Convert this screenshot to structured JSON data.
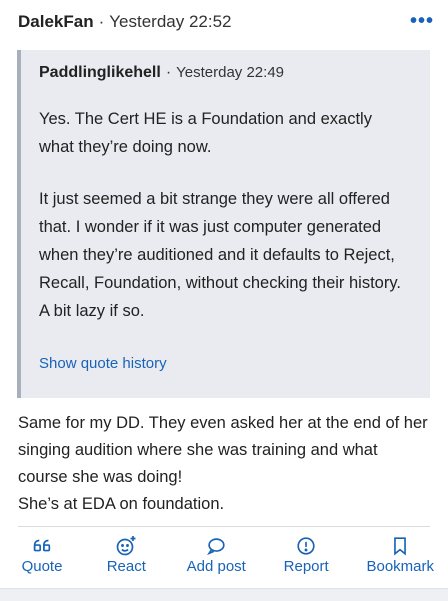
{
  "post": {
    "author": "DalekFan",
    "separator": "·",
    "timestamp": "Yesterday 22:52",
    "more_icon": "more-horizontal-icon"
  },
  "quote": {
    "author": "Paddlinglikehell",
    "separator": "·",
    "timestamp": "Yesterday 22:49",
    "paragraph1": "Yes. The Cert HE is a Foundation and exactly what they’re doing now.",
    "paragraph2": "It just seemed a bit strange they were all offered that. I wonder if it was just computer generated when they’re auditioned and it defaults to Reject, Recall, Foundation, without checking their history. A bit lazy if so.",
    "history_link": "Show quote history"
  },
  "reply": {
    "line1": "Same for my DD. They even asked her at the end of her singing audition where she was training and what course she was doing!",
    "line2": "She’s at EDA on foundation."
  },
  "actions": [
    {
      "label": "Quote",
      "icon": "quote-icon"
    },
    {
      "label": "React",
      "icon": "react-smiley-icon"
    },
    {
      "label": "Add post",
      "icon": "speech-bubble-icon"
    },
    {
      "label": "Report",
      "icon": "report-exclamation-icon"
    },
    {
      "label": "Bookmark",
      "icon": "bookmark-icon"
    }
  ],
  "colors": {
    "accent": "#1863b8",
    "quote_bg": "#e9ebf0",
    "quote_border": "#a9b0bd"
  }
}
